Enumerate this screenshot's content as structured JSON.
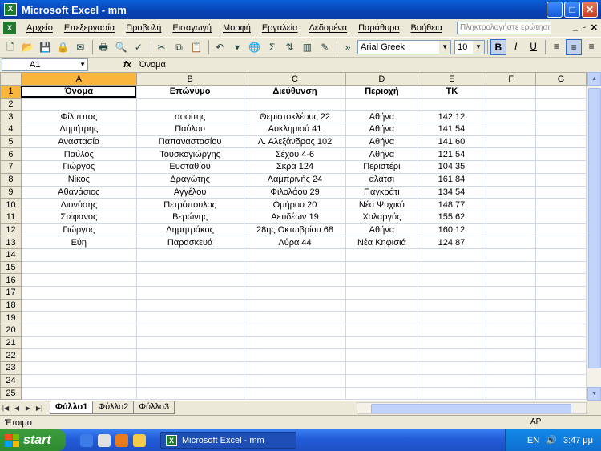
{
  "window": {
    "title": "Microsoft Excel - mm"
  },
  "menu": {
    "items": [
      "Αρχείο",
      "Επεξεργασία",
      "Προβολή",
      "Εισαγωγή",
      "Μορφή",
      "Εργαλεία",
      "Δεδομένα",
      "Παράθυρο",
      "Βοήθεια"
    ],
    "help_placeholder": "Πληκτρολογήστε ερώτηση"
  },
  "toolbar": {
    "font_name": "Arial Greek",
    "font_size": "10",
    "bold_label": "B",
    "italic_label": "I",
    "underline_label": "U",
    "sigma_label": "Σ"
  },
  "formula_bar": {
    "cell_ref": "A1",
    "fx_label": "fx",
    "content": "Όνομα"
  },
  "grid": {
    "columns": [
      "A",
      "B",
      "C",
      "D",
      "E",
      "F",
      "G"
    ],
    "rows": [
      [
        "Όνομα",
        "Επώνυμο",
        "Διεύθυνση",
        "Περιοχή",
        "ΤΚ"
      ],
      [
        "",
        "",
        "",
        "",
        ""
      ],
      [
        "Φίλιππος",
        "σοφίτης",
        "Θεμιστοκλέους 22",
        "Αθήνα",
        "142 12"
      ],
      [
        "Δημήτρης",
        "Παύλου",
        "Αυκλημιού 41",
        "Αθήνα",
        "141 54"
      ],
      [
        "Αναστασία",
        "Παπαναστασίου",
        "Λ. Αλεξάνδρας 102",
        "Αθήνα",
        "141 60"
      ],
      [
        "Παύλος",
        "Τουσκογιώργης",
        "Σέχου 4-6",
        "Αθήνα",
        "121 54"
      ],
      [
        "Γιώργος",
        "Ευσταθίου",
        "Σκρα 124",
        "Περιστέρι",
        "104 35"
      ],
      [
        "Νίκος",
        "Δραγώτης",
        "Λαμπρινής 24",
        "αλάτσι",
        "161 84"
      ],
      [
        "Αθανάσιος",
        "Αγγέλου",
        "Φιλολάου 29",
        "Παγκράτι",
        "134 54"
      ],
      [
        "Διονύσης",
        "Πετρόπουλος",
        "Ομήρου 20",
        "Νέο Ψυχικό",
        "148 77"
      ],
      [
        "Στέφανος",
        "Βερώνης",
        "Αετιδέων 19",
        "Χολαργός",
        "155 62"
      ],
      [
        "Γιώργος",
        "Δημητράκος",
        "28ης Οκτωβρίου 68",
        "Αθήνα",
        "160 12"
      ],
      [
        "Εύη",
        "Παρασκευά",
        "Λύρα 44",
        "Νέα Κηφισιά",
        "124 87"
      ]
    ],
    "row_numbers": [
      "1",
      "2",
      "3",
      "4",
      "5",
      "6",
      "7",
      "8",
      "9",
      "10",
      "11",
      "12",
      "13",
      "14",
      "15",
      "16",
      "17",
      "18",
      "19",
      "20",
      "21",
      "22",
      "23",
      "24",
      "25"
    ]
  },
  "sheets": {
    "tabs": [
      "Φύλλο1",
      "Φύλλο2",
      "Φύλλο3"
    ],
    "active": "Φύλλο1"
  },
  "status": {
    "text": "Έτοιμο",
    "indicator": "ΑΡ"
  },
  "taskbar": {
    "start_label": "start",
    "task_label": "Microsoft Excel - mm",
    "lang": "EN",
    "clock": "3:47 μμ"
  }
}
